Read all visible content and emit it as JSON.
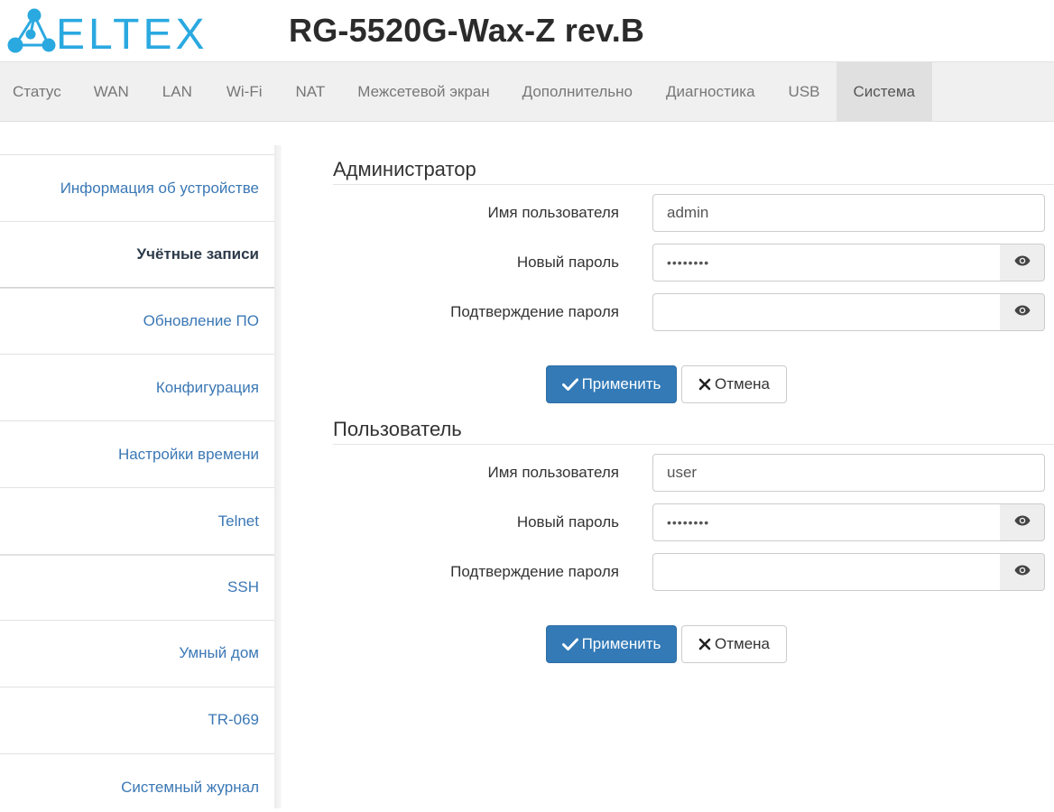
{
  "brand": {
    "logo_text": "ELTEX",
    "model": "RG-5520G-Wax-Z rev.B",
    "accent_color": "#2aa9e0"
  },
  "nav": {
    "items": [
      {
        "label": "Статус"
      },
      {
        "label": "WAN"
      },
      {
        "label": "LAN"
      },
      {
        "label": "Wi-Fi"
      },
      {
        "label": "NAT"
      },
      {
        "label": "Межсетевой экран"
      },
      {
        "label": "Дополнительно"
      },
      {
        "label": "Диагностика"
      },
      {
        "label": "USB"
      },
      {
        "label": "Система",
        "active": true
      }
    ]
  },
  "sidebar": {
    "items": [
      {
        "label": "Информация об устройстве"
      },
      {
        "label": "Учётные записи",
        "active": true
      },
      {
        "label": "Обновление ПО"
      },
      {
        "label": "Конфигурация"
      },
      {
        "label": "Настройки времени"
      },
      {
        "label": "Telnet"
      },
      {
        "label": "SSH"
      },
      {
        "label": "Умный дом"
      },
      {
        "label": "TR-069"
      },
      {
        "label": "Системный журнал"
      }
    ]
  },
  "admin": {
    "title": "Администратор",
    "username_label": "Имя пользователя",
    "username_value": "admin",
    "new_password_label": "Новый пароль",
    "new_password_value": "••••••••",
    "confirm_password_label": "Подтверждение пароля",
    "confirm_password_value": "",
    "apply_label": "Применить",
    "cancel_label": "Отмена"
  },
  "user": {
    "title": "Пользователь",
    "username_label": "Имя пользователя",
    "username_value": "user",
    "new_password_label": "Новый пароль",
    "new_password_value": "••••••••",
    "confirm_password_label": "Подтверждение пароля",
    "confirm_password_value": "",
    "apply_label": "Применить",
    "cancel_label": "Отмена"
  },
  "icons": {
    "show_password": "eye-icon",
    "apply": "check-icon",
    "cancel": "x-icon"
  }
}
